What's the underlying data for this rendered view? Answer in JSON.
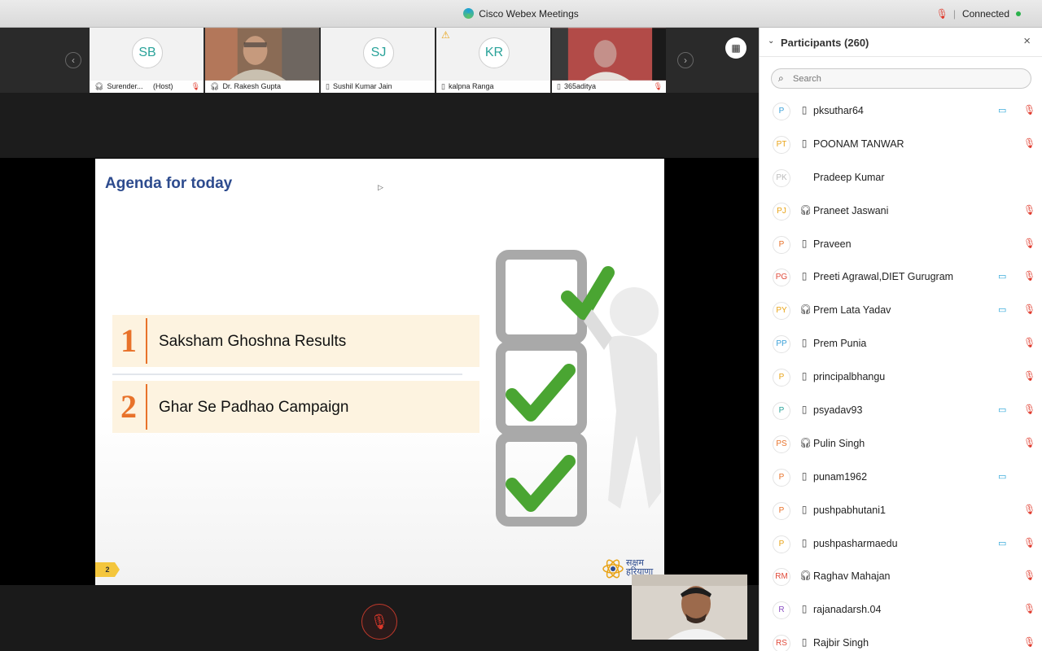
{
  "window": {
    "app_title": "Cisco Webex Meetings",
    "status": "Connected"
  },
  "stage": {
    "tiles": [
      {
        "initials": "SB",
        "name": "Surender...",
        "role": "(Host)",
        "device": "headset-icon",
        "muted": true,
        "video": false
      },
      {
        "initials": "",
        "name": "Dr. Rakesh Gupta",
        "role": "",
        "device": "headset-icon",
        "muted": false,
        "video": true
      },
      {
        "initials": "SJ",
        "name": "Sushil Kumar Jain",
        "role": "",
        "device": "phone-icon",
        "muted": false,
        "video": false
      },
      {
        "initials": "KR",
        "name": "kalpna Ranga",
        "role": "",
        "device": "phone-icon",
        "muted": false,
        "video": false,
        "warning": true
      },
      {
        "initials": "",
        "name": "365aditya",
        "role": "",
        "device": "phone-icon",
        "muted": true,
        "video": true
      }
    ]
  },
  "slide": {
    "title": "Agenda for today",
    "items": [
      {
        "number": "1",
        "label": "Saksham Ghoshna Results"
      },
      {
        "number": "2",
        "label": "Ghar Se Padhao Campaign"
      }
    ],
    "page_number": "2",
    "logo_text": "सक्षम हरियाणा"
  },
  "panel": {
    "title": "Participants (260)",
    "search_placeholder": "Search",
    "participants": [
      {
        "initials": "P",
        "color": "#3aa0d8",
        "device": "phone",
        "name": "pksuthar64",
        "video": true,
        "muted": true
      },
      {
        "initials": "PT",
        "color": "#e8a317",
        "device": "phone",
        "name": "POONAM TANWAR",
        "video": false,
        "muted": true
      },
      {
        "initials": "PK",
        "color": "#bbbbbb",
        "device": "none",
        "name": "Pradeep Kumar",
        "video": false,
        "muted": false
      },
      {
        "initials": "PJ",
        "color": "#e8a317",
        "device": "headset",
        "name": "Praneet Jaswani",
        "video": false,
        "muted": true
      },
      {
        "initials": "P",
        "color": "#e8722a",
        "device": "phone",
        "name": "Praveen",
        "video": false,
        "muted": true
      },
      {
        "initials": "PG",
        "color": "#e04a3a",
        "device": "phone",
        "name": "Preeti Agrawal,DIET Gurugram",
        "video": true,
        "muted": true
      },
      {
        "initials": "PY",
        "color": "#e8a317",
        "device": "headset",
        "name": "Prem Lata Yadav",
        "video": true,
        "muted": true
      },
      {
        "initials": "PP",
        "color": "#3aa0d8",
        "device": "phone",
        "name": "Prem Punia",
        "video": false,
        "muted": true
      },
      {
        "initials": "P",
        "color": "#e8a317",
        "device": "phone",
        "name": "principalbhangu",
        "video": false,
        "muted": true
      },
      {
        "initials": "P",
        "color": "#2aa39a",
        "device": "phone",
        "name": "psyadav93",
        "video": true,
        "muted": true
      },
      {
        "initials": "PS",
        "color": "#e8722a",
        "device": "headset",
        "name": "Pulin Singh",
        "video": false,
        "muted": true
      },
      {
        "initials": "P",
        "color": "#e8722a",
        "device": "phone",
        "name": "punam1962",
        "video": true,
        "muted": false
      },
      {
        "initials": "P",
        "color": "#e8722a",
        "device": "phone",
        "name": "pushpabhutani1",
        "video": false,
        "muted": true
      },
      {
        "initials": "P",
        "color": "#e8a317",
        "device": "phone",
        "name": "pushpasharmaedu",
        "video": true,
        "muted": true
      },
      {
        "initials": "RM",
        "color": "#e04a3a",
        "device": "headset",
        "name": "Raghav Mahajan",
        "video": false,
        "muted": true
      },
      {
        "initials": "R",
        "color": "#8a4fc2",
        "device": "phone",
        "name": "rajanadarsh.04",
        "video": false,
        "muted": true
      },
      {
        "initials": "RS",
        "color": "#e04a3a",
        "device": "phone",
        "name": "Rajbir Singh",
        "video": false,
        "muted": true
      }
    ]
  }
}
